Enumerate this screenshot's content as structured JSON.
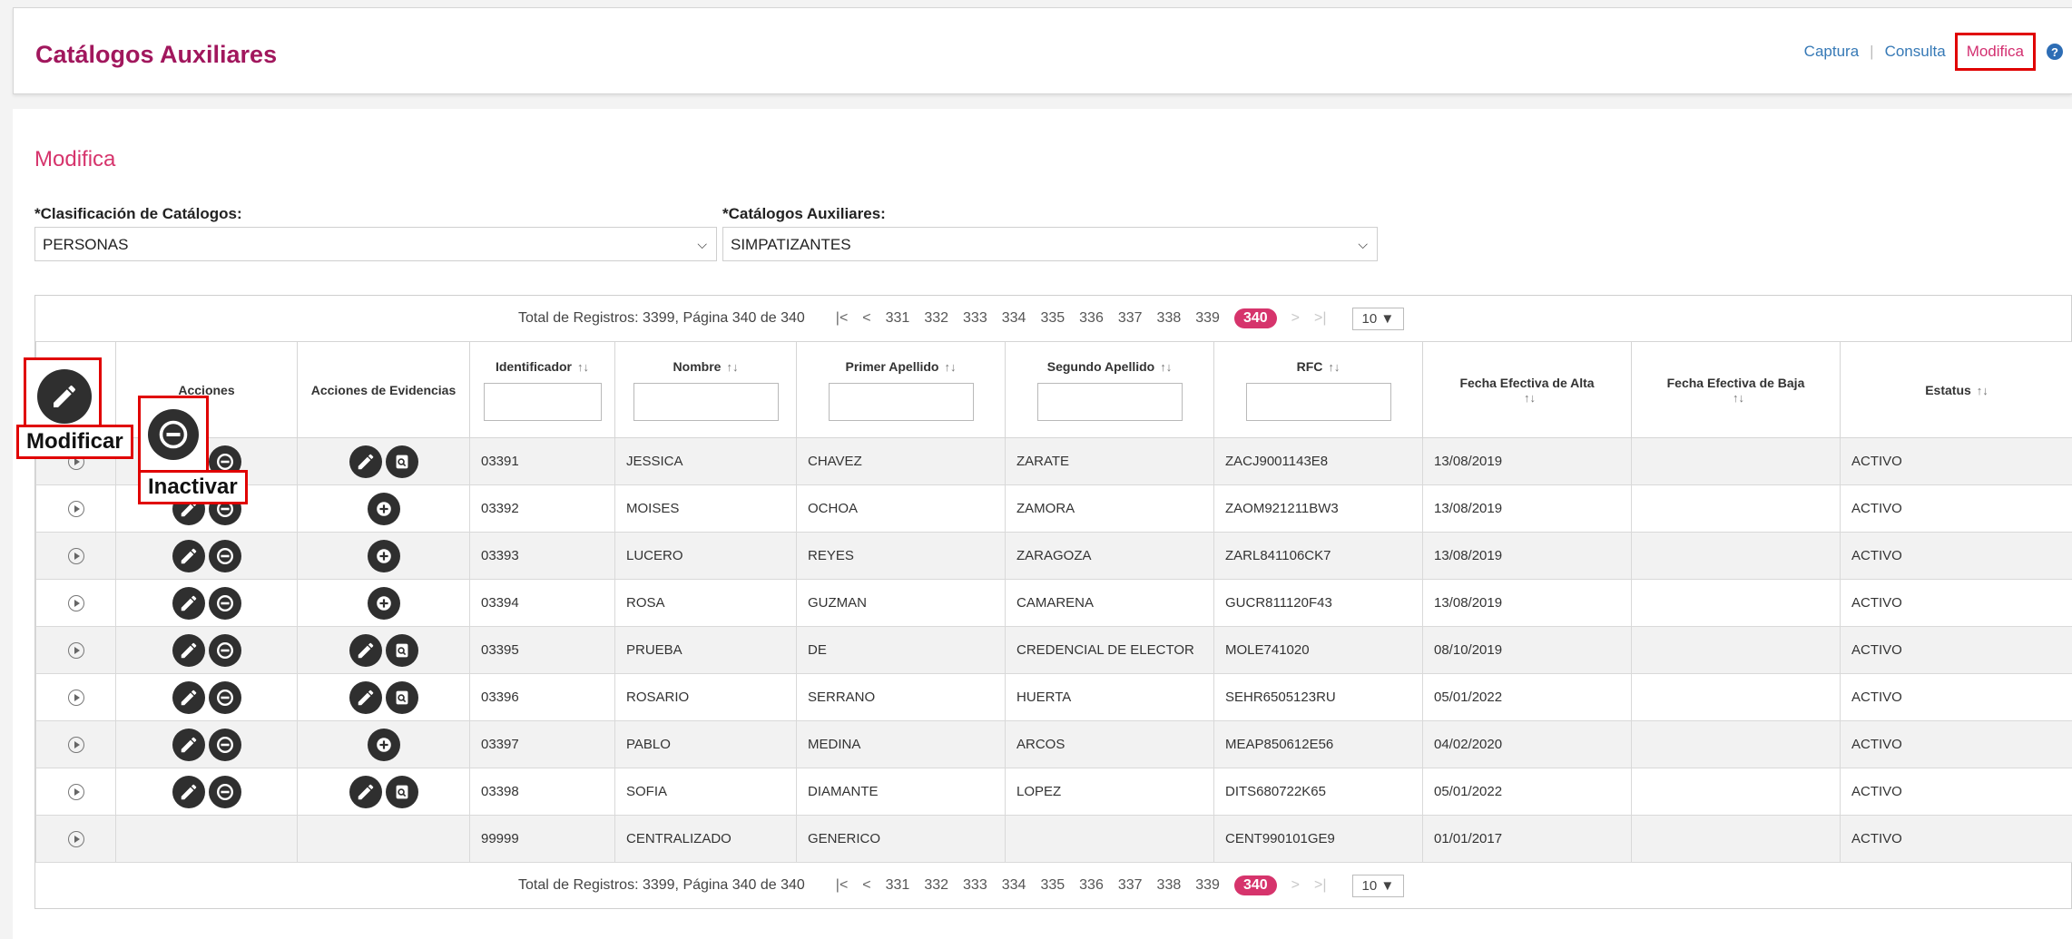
{
  "header": {
    "title": "Catálogos Auxiliares",
    "nav": {
      "capture": "Captura",
      "query": "Consulta",
      "modify": "Modifica",
      "separator": "|"
    }
  },
  "section": {
    "title": "Modifica"
  },
  "filters": {
    "classification_label": "*Clasificación de Catálogos:",
    "classification_value": "PERSONAS",
    "catalog_label": "*Catálogos Auxiliares:",
    "catalog_value": "SIMPATIZANTES"
  },
  "pager": {
    "total": "Total de Registros: 3399, Página 340 de 340",
    "pages": [
      "331",
      "332",
      "333",
      "334",
      "335",
      "336",
      "337",
      "338",
      "339"
    ],
    "current": "340",
    "page_size": "10"
  },
  "columns": {
    "actions": "Acciones",
    "evidence_actions": "Acciones de Evidencias",
    "id": "Identificador",
    "name": "Nombre",
    "last1": "Primer Apellido",
    "last2": "Segundo Apellido",
    "rfc": "RFC",
    "start": "Fecha Efectiva de Alta",
    "end": "Fecha Efectiva de Baja",
    "status": "Estatus"
  },
  "rows": [
    {
      "id": "03391",
      "name": "JESSICA",
      "last1": "CHAVEZ",
      "last2": "ZARATE",
      "rfc": "ZACJ9001143E8",
      "start": "13/08/2019",
      "end": "",
      "status": "ACTIVO",
      "actions": true,
      "evidence": "edit-view"
    },
    {
      "id": "03392",
      "name": "MOISES",
      "last1": "OCHOA",
      "last2": "ZAMORA",
      "rfc": "ZAOM921211BW3",
      "start": "13/08/2019",
      "end": "",
      "status": "ACTIVO",
      "actions": true,
      "evidence": "add"
    },
    {
      "id": "03393",
      "name": "LUCERO",
      "last1": "REYES",
      "last2": "ZARAGOZA",
      "rfc": "ZARL841106CK7",
      "start": "13/08/2019",
      "end": "",
      "status": "ACTIVO",
      "actions": true,
      "evidence": "add"
    },
    {
      "id": "03394",
      "name": "ROSA",
      "last1": "GUZMAN",
      "last2": "CAMARENA",
      "rfc": "GUCR811120F43",
      "start": "13/08/2019",
      "end": "",
      "status": "ACTIVO",
      "actions": true,
      "evidence": "add"
    },
    {
      "id": "03395",
      "name": "PRUEBA",
      "last1": "DE",
      "last2": "CREDENCIAL DE ELECTOR",
      "rfc": "MOLE741020",
      "start": "08/10/2019",
      "end": "",
      "status": "ACTIVO",
      "actions": true,
      "evidence": "edit-view"
    },
    {
      "id": "03396",
      "name": "ROSARIO",
      "last1": "SERRANO",
      "last2": "HUERTA",
      "rfc": "SEHR6505123RU",
      "start": "05/01/2022",
      "end": "",
      "status": "ACTIVO",
      "actions": true,
      "evidence": "edit-view"
    },
    {
      "id": "03397",
      "name": "PABLO",
      "last1": "MEDINA",
      "last2": "ARCOS",
      "rfc": "MEAP850612E56",
      "start": "04/02/2020",
      "end": "",
      "status": "ACTIVO",
      "actions": true,
      "evidence": "add"
    },
    {
      "id": "03398",
      "name": "SOFIA",
      "last1": "DIAMANTE",
      "last2": "LOPEZ",
      "rfc": "DITS680722K65",
      "start": "05/01/2022",
      "end": "",
      "status": "ACTIVO",
      "actions": true,
      "evidence": "edit-view"
    },
    {
      "id": "99999",
      "name": "CENTRALIZADO",
      "last1": "GENERICO",
      "last2": "",
      "rfc": "CENT990101GE9",
      "start": "01/01/2017",
      "end": "",
      "status": "ACTIVO",
      "actions": false,
      "evidence": "none"
    }
  ],
  "callouts": {
    "modify": "Modificar",
    "inactivate": "Inactivar"
  },
  "colors": {
    "brand": "#a1175d",
    "accent": "#d6346c",
    "link": "#3679b6",
    "highlight": "#e00000",
    "button": "#2f2f2f"
  }
}
